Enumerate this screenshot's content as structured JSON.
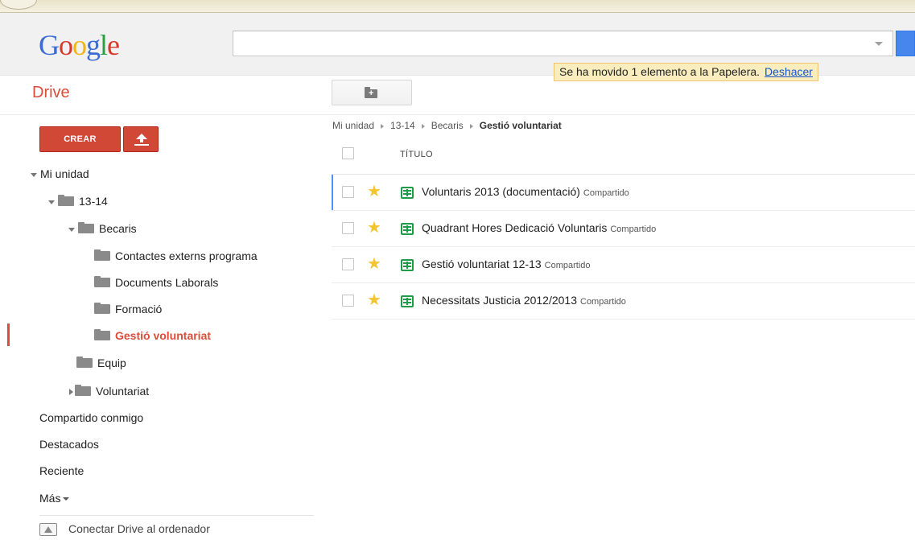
{
  "app": {
    "logo_text": "Google",
    "product": "Drive"
  },
  "search": {
    "value": "",
    "placeholder": ""
  },
  "notification": {
    "message": "Se ha movido 1 elemento a la Papelera.",
    "undo_label": "Deshacer"
  },
  "toolbar": {
    "new_folder_icon": "new-folder-icon"
  },
  "sidebar": {
    "create_label": "CREAR",
    "upload_icon": "upload-icon",
    "tree": {
      "my_drive": "Mi unidad",
      "folder_1314": "13-14",
      "becaris": "Becaris",
      "contactes": "Contactes externs programa",
      "documents": "Documents Laborals",
      "formacio": "Formació",
      "gestio": "Gestió voluntariat",
      "equip": "Equip",
      "voluntariat": "Voluntariat"
    },
    "shared_with_me": "Compartido conmigo",
    "starred": "Destacados",
    "recent": "Reciente",
    "more": "Más",
    "connect_drive": "Conectar Drive al ordenador"
  },
  "breadcrumb": {
    "items": [
      "Mi unidad",
      "13-14",
      "Becaris"
    ],
    "current": "Gestió voluntariat"
  },
  "file_list": {
    "column_title": "TÍTULO",
    "files": [
      {
        "name": "Voluntaris 2013 (documentació)",
        "status": "Compartido",
        "starred": true,
        "type": "spreadsheet"
      },
      {
        "name": "Quadrant Hores Dedicació Voluntaris",
        "status": "Compartido",
        "starred": true,
        "type": "spreadsheet"
      },
      {
        "name": "Gestió voluntariat 12-13",
        "status": "Compartido",
        "starred": true,
        "type": "spreadsheet"
      },
      {
        "name": "Necessitats Justicia 2012/2013",
        "status": "Compartido",
        "starred": true,
        "type": "spreadsheet"
      }
    ]
  },
  "colors": {
    "accent_red": "#dd4b39",
    "button_red": "#d14836",
    "link_blue": "#1155cc",
    "notice_bg": "#f9edbe",
    "sheet_green": "#1f9c4a",
    "star_yellow": "#f4c431",
    "focus_blue": "#4d90fe"
  }
}
